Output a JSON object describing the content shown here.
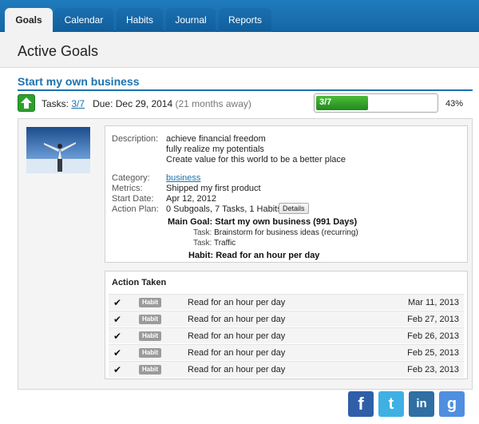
{
  "nav": {
    "tabs": [
      {
        "label": "Goals",
        "active": true
      },
      {
        "label": "Calendar",
        "active": false
      },
      {
        "label": "Habits",
        "active": false
      },
      {
        "label": "Journal",
        "active": false
      },
      {
        "label": "Reports",
        "active": false
      }
    ]
  },
  "page": {
    "title": "Active Goals"
  },
  "goal": {
    "title": "Start my own business",
    "tasks_label": "Tasks:",
    "tasks_link": "3/7",
    "due_label": "Due:",
    "due_date": "Dec 29, 2014",
    "due_relative": "(21 months away)",
    "progress": {
      "text": "3/7",
      "fraction": 0.4286,
      "percent_label": "43%"
    },
    "details": {
      "description_label": "Description:",
      "description_lines": [
        "achieve financial freedom",
        "fully realize my potentials",
        "Create value for this world to be a better place"
      ],
      "category_label": "Category:",
      "category": "business",
      "metrics_label": "Metrics:",
      "metrics": "Shipped my first product",
      "start_label": "Start Date:",
      "start_date": "Apr 12, 2012",
      "plan_label": "Action Plan:",
      "plan": "0 Subgoals, 7 Tasks, 1 Habits",
      "details_button": "Details",
      "main_goal_key": "Main Goal:",
      "main_goal_value": "Start my own business (991 Days)",
      "task_key": "Task:",
      "task1": "Brainstorm for business ideas (recurring)",
      "task2": "Traffic",
      "habit_key": "Habit:",
      "habit_value": "Read for an hour per day"
    },
    "action_taken": {
      "title": "Action Taken",
      "rows": [
        {
          "badge": "Habit",
          "text": "Read for an hour per day",
          "date": "Mar 11, 2013"
        },
        {
          "badge": "Habit",
          "text": "Read for an hour per day",
          "date": "Feb 27, 2013"
        },
        {
          "badge": "Habit",
          "text": "Read for an hour per day",
          "date": "Feb 26, 2013"
        },
        {
          "badge": "Habit",
          "text": "Read for an hour per day",
          "date": "Feb 25, 2013"
        },
        {
          "badge": "Habit",
          "text": "Read for an hour per day",
          "date": "Feb 23, 2013"
        }
      ]
    }
  },
  "share": [
    {
      "icon": "facebook-icon",
      "glyph": "f",
      "color": "#2f5fa8"
    },
    {
      "icon": "twitter-icon",
      "glyph": "t",
      "color": "#3fb0e4"
    },
    {
      "icon": "linkedin-icon",
      "glyph": "in",
      "color": "#2f6fa3"
    },
    {
      "icon": "google-icon",
      "glyph": "g",
      "color": "#4f8fe0"
    }
  ],
  "colors": {
    "accent": "#1b72ae",
    "nav": "#1567a6",
    "progress": "#2e9f2e"
  }
}
